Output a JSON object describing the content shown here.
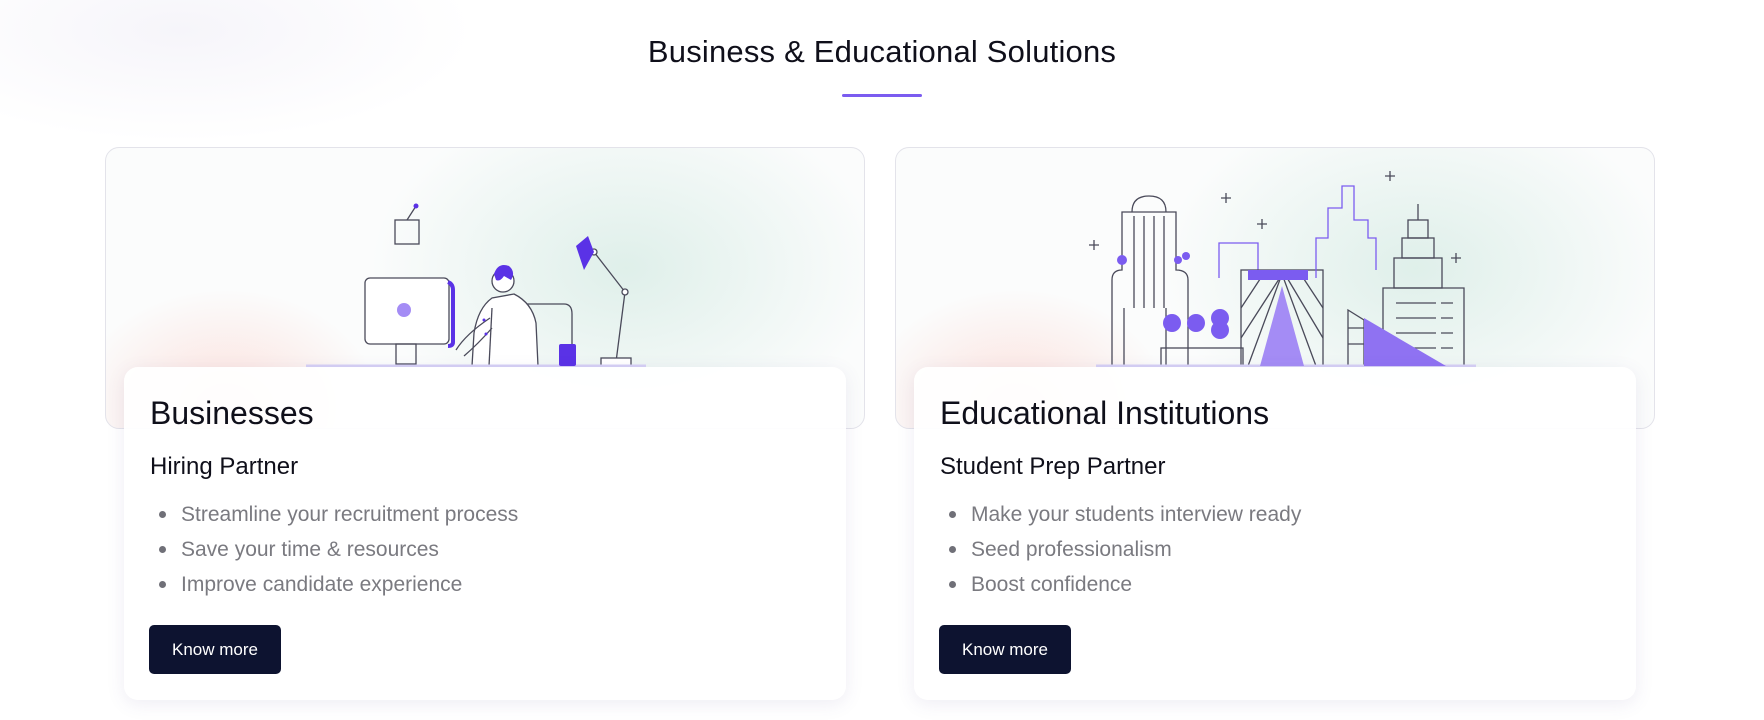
{
  "section": {
    "title": "Business & Educational Solutions"
  },
  "colors": {
    "accent": "#7b5cf0",
    "button_bg": "#0d1330",
    "heading_text": "#0f0f1a",
    "body_text": "#7a7a80"
  },
  "cards": [
    {
      "illustration": "person-at-desk-illustration",
      "heading": "Businesses",
      "subheading": "Hiring Partner",
      "points": [
        "Streamline your recruitment process",
        "Save your time & resources",
        "Improve candidate experience"
      ],
      "button_label": "Know more"
    },
    {
      "illustration": "city-buildings-illustration",
      "heading": "Educational Institutions",
      "subheading": "Student Prep Partner",
      "points": [
        "Make your students interview ready",
        "Seed professionalism",
        "Boost confidence"
      ],
      "button_label": "Know more"
    }
  ]
}
